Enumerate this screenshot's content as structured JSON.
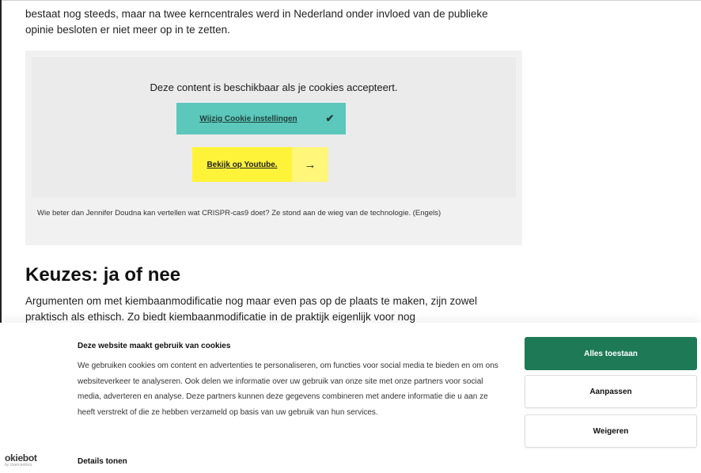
{
  "article": {
    "intro_text": "bestaat nog steeds, maar na twee kerncentrales werd in Nederland onder invloed van de publieke opinie besloten er niet meer op in te zetten.",
    "embed": {
      "message": "Deze content is beschikbaar als je cookies accepteert.",
      "cookie_button_label": "Wijzig Cookie instellingen",
      "cookie_button_icon": "✔",
      "youtube_button_label": "Bekijk op Youtube.",
      "youtube_button_icon": "→",
      "cookie_button_color": "#5cc7bb",
      "youtube_button_color": "#fff33a"
    },
    "caption": "Wie beter dan Jennifer Doudna kan vertellen wat CRISPR-cas9 doet? Ze stond aan de wieg van de technologie. (Engels)",
    "heading": "Keuzes: ja of nee",
    "paragraph": "Argumenten om met kiembaanmodificatie nog maar even pas op de plaats te maken, zijn zowel praktisch als ethisch. Zo biedt kiembaanmodificatie in de praktijk eigenlijk voor nog"
  },
  "cookie_banner": {
    "title": "Deze website maakt gebruik van cookies",
    "text": "We gebruiken cookies om content en advertenties te personaliseren, om functies voor social media te bieden en om ons websiteverkeer te analyseren. Ook delen we informatie over uw gebruik van onze site met onze partners voor social media, adverteren en analyse. Deze partners kunnen deze gegevens combineren met andere informatie die u aan ze heeft verstrekt of die ze hebben verzameld op basis van uw gebruik van hun services.",
    "details_link": "Details tonen",
    "logo_text": "okiebot",
    "logo_subtext": "by Usercentrics",
    "allow_all_label": "Alles toestaan",
    "customize_label": "Aanpassen",
    "decline_label": "Weigeren",
    "accent_color": "#1e7a56"
  }
}
